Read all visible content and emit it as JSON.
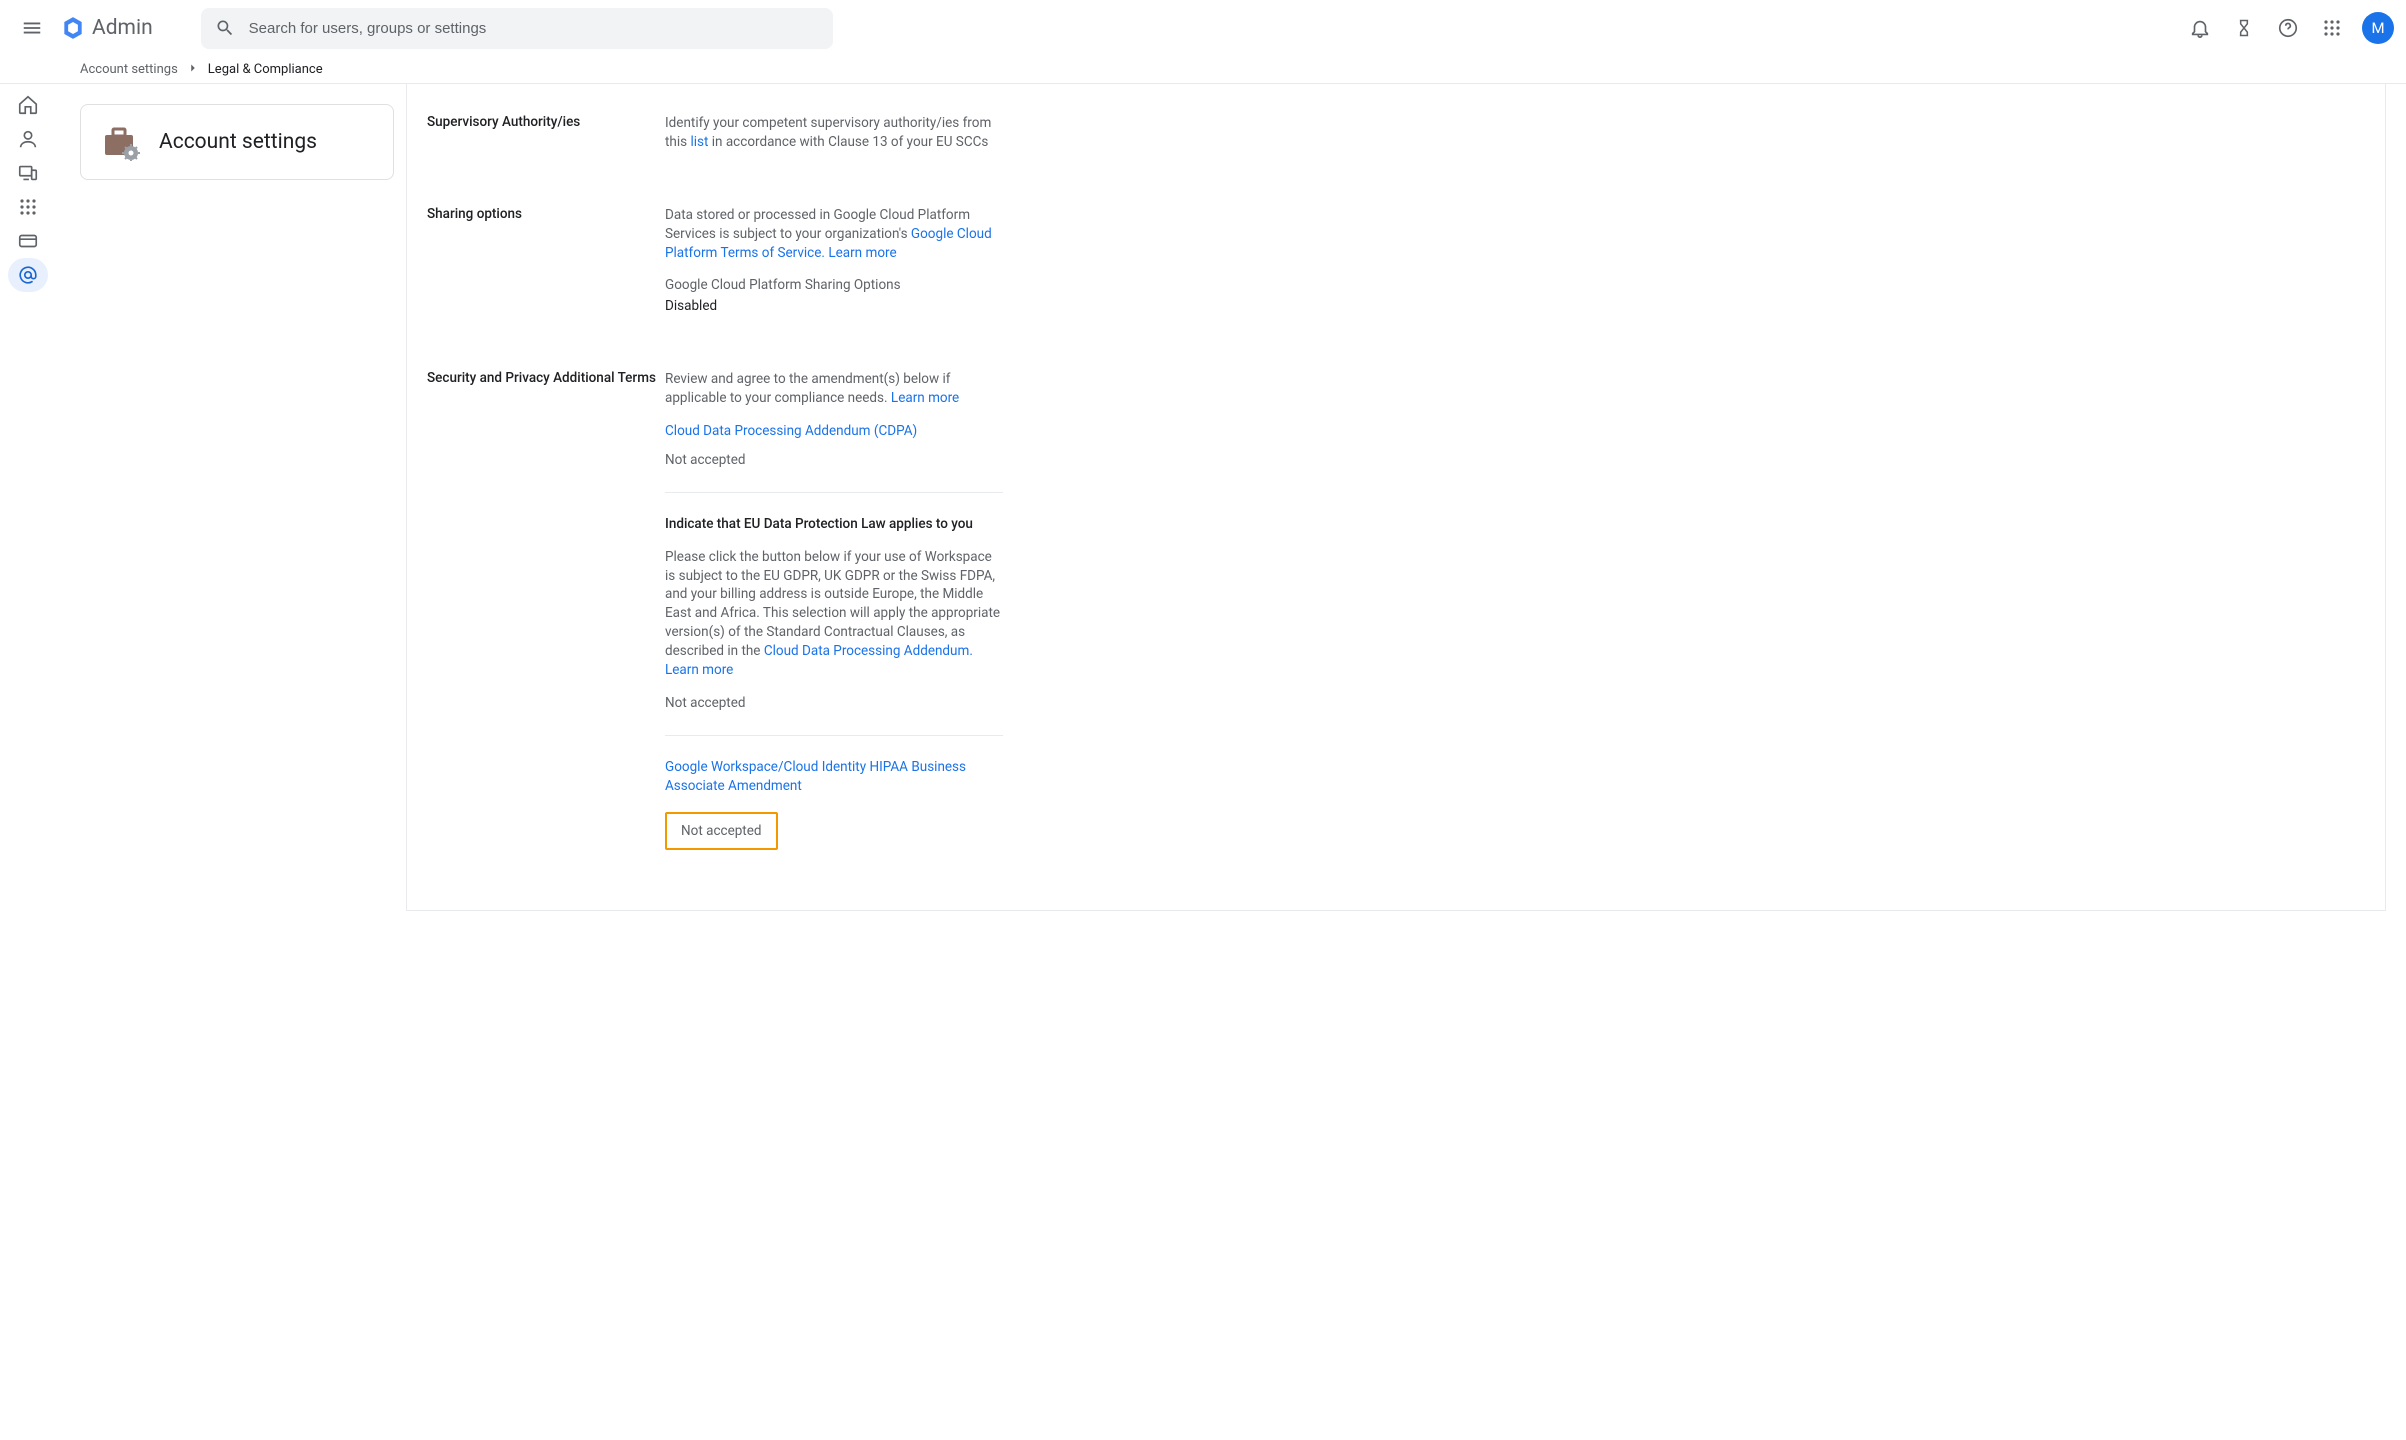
{
  "header": {
    "app_title": "Admin",
    "search_placeholder": "Search for users, groups or settings",
    "avatar_letter": "M"
  },
  "breadcrumb": {
    "parent": "Account settings",
    "current": "Legal & Compliance"
  },
  "left_card": {
    "title": "Account settings"
  },
  "sections": {
    "supervisory": {
      "label": "Supervisory Authority/ies",
      "desc_pre": "Identify your competent supervisory authority/ies from this ",
      "link": "list",
      "desc_post": " in accordance with Clause 13 of your EU SCCs"
    },
    "sharing": {
      "label": "Sharing options",
      "desc_pre": "Data stored or processed in Google Cloud Platform Services is subject to your organization's ",
      "link1": "Google Cloud Platform Terms of Service.",
      "link2": "Learn more",
      "sublabel": "Google Cloud Platform Sharing Options",
      "value": "Disabled"
    },
    "security": {
      "label": "Security and Privacy Additional Terms",
      "desc": "Review and agree to the amendment(s) below if applicable to your compliance needs. ",
      "learn_more": "Learn more",
      "item1_link": "Cloud Data Processing Addendum (CDPA)",
      "item1_status": "Not accepted",
      "eu_heading": "Indicate that EU Data Protection Law applies to you",
      "eu_desc": "Please click the button below if your use of Workspace is subject to the EU GDPR, UK GDPR or the Swiss FDPA, and your billing address is outside Europe, the Middle East and Africa. This selection will apply the appropriate version(s) of the Standard Contractual Clauses, as described in the ",
      "eu_link": "Cloud Data Processing Addendum.",
      "eu_learn_more": "Learn more",
      "eu_status": "Not accepted",
      "hipaa_link": "Google Workspace/Cloud Identity HIPAA Business Associate Amendment",
      "hipaa_status": "Not accepted"
    }
  }
}
